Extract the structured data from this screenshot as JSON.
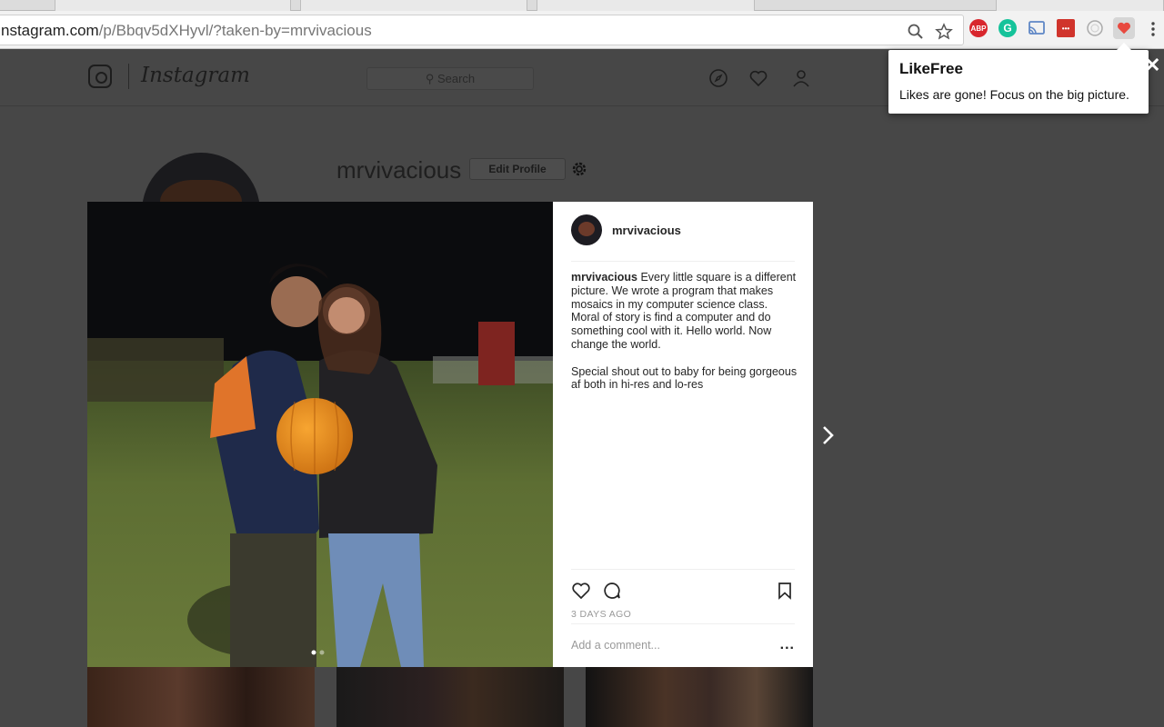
{
  "browser": {
    "url_host": "nstagram.com",
    "url_path": "/p/Bbqv5dXHyvl/?taken-by=mrvivacious",
    "extensions": [
      {
        "name": "adblock-plus",
        "label": "ABP",
        "color": "#d8262d"
      },
      {
        "name": "grammarly",
        "label": "",
        "color": "#15c39a"
      },
      {
        "name": "cast",
        "label": "",
        "color": "#5f87c6"
      },
      {
        "name": "toolbar-red",
        "label": "",
        "color": "#d0342c"
      },
      {
        "name": "circle-ext",
        "label": "",
        "color": "#c8c8c8"
      },
      {
        "name": "likefree",
        "label": "",
        "color": "#e8493f"
      }
    ]
  },
  "instagram": {
    "wordmark": "Instagram",
    "search_placeholder": "Search",
    "profile_username": "mrvivacious",
    "edit_profile_label": "Edit Profile"
  },
  "post": {
    "username": "mrvivacious",
    "caption_user": "mrvivacious",
    "caption_text": " Every little square is a different picture. We wrote a program that makes mosaics in my computer science class.\nMoral of story is find a computer and do something cool with it. Hello world. Now change the world.\n\nSpecial shout out to baby for being gorgeous af both in hi-res and lo-res",
    "timestamp": "3 DAYS AGO",
    "comment_placeholder": "Add a comment...",
    "more_label": "..."
  },
  "popup": {
    "title": "LikeFree",
    "message": "Likes are gone! Focus on the big picture."
  },
  "colors": {
    "overlay": "#474747",
    "likefree_heart": "#e8493f",
    "pumpkin": "#e98a1c"
  }
}
